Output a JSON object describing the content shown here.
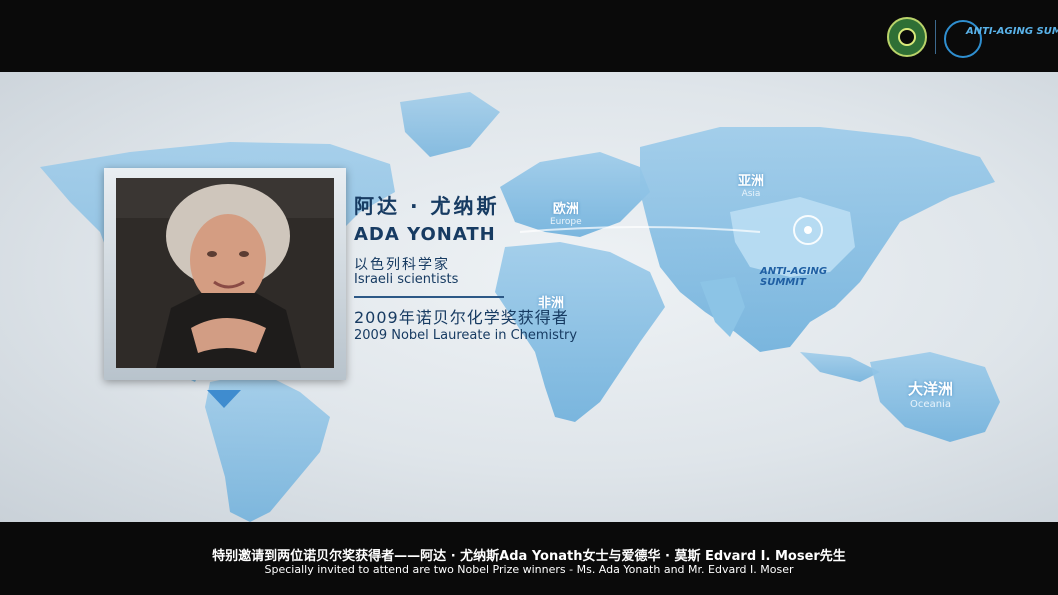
{
  "header": {
    "logo_left": "seal-logo",
    "logo_right_text": "ANTI-AGING SUMMIT"
  },
  "map": {
    "regions": [
      {
        "cn": "亚洲",
        "en": "Asia"
      },
      {
        "cn": "欧洲",
        "en": "Europe"
      },
      {
        "cn": "非洲",
        "en": ""
      },
      {
        "cn": "大洋洲",
        "en": "Oceania"
      }
    ],
    "badge_text": "ANTI-AGING SUMMIT"
  },
  "profile": {
    "name_cn": "阿达 · 尤纳斯",
    "name_en": "ADA YONATH",
    "nationality_cn": "以色列科学家",
    "nationality_en": "Israeli scientists",
    "award_cn": "2009年诺贝尔化学奖获得者",
    "award_en": "2009 Nobel Laureate in Chemistry"
  },
  "caption": {
    "cn": "特别邀请到两位诺贝尔奖获得者——阿达 · 尤纳斯Ada Yonath女士与爱德华 · 莫斯 Edvard I. Moser先生",
    "en": "Specially invited to attend are two Nobel Prize winners - Ms. Ada Yonath and Mr. Edvard I. Moser"
  },
  "colors": {
    "map_fill": "#7fbde3",
    "text_dark": "#173b62",
    "bar": "#0a0a0a"
  }
}
